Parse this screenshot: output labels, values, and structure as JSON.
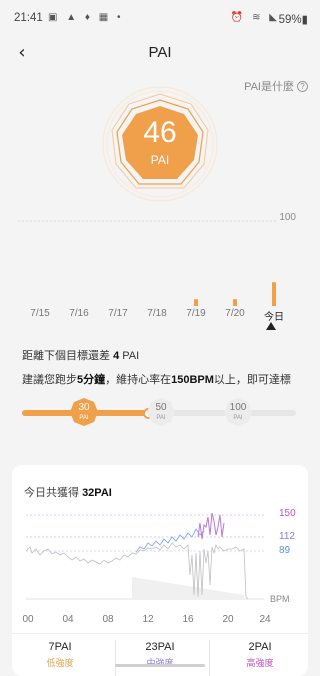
{
  "status_bar": {
    "time": "21:41",
    "left_icons": "▣ ▲ ♦ ▦ •",
    "right_icons": "⏰ ≋ ◣",
    "battery": "59%▮"
  },
  "header": {
    "back_icon": "‹",
    "title": "PAI"
  },
  "help": {
    "label": "PAI是什麼",
    "icon": "?"
  },
  "badge": {
    "value": "46",
    "unit": "PAI",
    "color": "#f0a04a"
  },
  "chart_data": {
    "type": "bar",
    "categories": [
      "7/15",
      "7/16",
      "7/17",
      "7/18",
      "7/19",
      "7/20",
      "今日"
    ],
    "values": [
      0,
      0,
      0,
      0,
      8,
      8,
      28
    ],
    "ylim": [
      0,
      100
    ],
    "goal_label": "100",
    "selected_index": 6,
    "color": "#f0a04a"
  },
  "goal_gap": {
    "prefix": "距離下個目標還差",
    "value": "4",
    "suffix": " PAI"
  },
  "suggestion": {
    "part1": "建議您跑步",
    "minutes": "5分鐘",
    "part2": "，維持心率在",
    "bpm": "150BPM",
    "part3": "以上，即可達標"
  },
  "progress": {
    "current_fraction": 0.46,
    "milestones": [
      {
        "value": "30",
        "unit": "PAI",
        "reached": true
      },
      {
        "value": "50",
        "unit": "PAI",
        "reached": false
      },
      {
        "value": "100",
        "unit": "PAI",
        "reached": false
      }
    ]
  },
  "today_card": {
    "title_prefix": "今日共獲得",
    "title_value": "32PAI",
    "hr_high": "150",
    "hr_mid": "112",
    "hr_low": "89",
    "bpm_label": "BPM",
    "hours": [
      "00",
      "04",
      "08",
      "12",
      "16",
      "20",
      "24"
    ],
    "colors": {
      "high": "#c24fc8",
      "mid": "#8a7ae0",
      "low": "#5d8ee8"
    },
    "summary": [
      {
        "value": "7PAI",
        "label": "低強度",
        "color": "#e8a24a"
      },
      {
        "value": "23PAI",
        "label": "中強度",
        "color": "#8a7ae0"
      },
      {
        "value": "2PAI",
        "label": "高強度",
        "color": "#c24fc8"
      }
    ]
  }
}
